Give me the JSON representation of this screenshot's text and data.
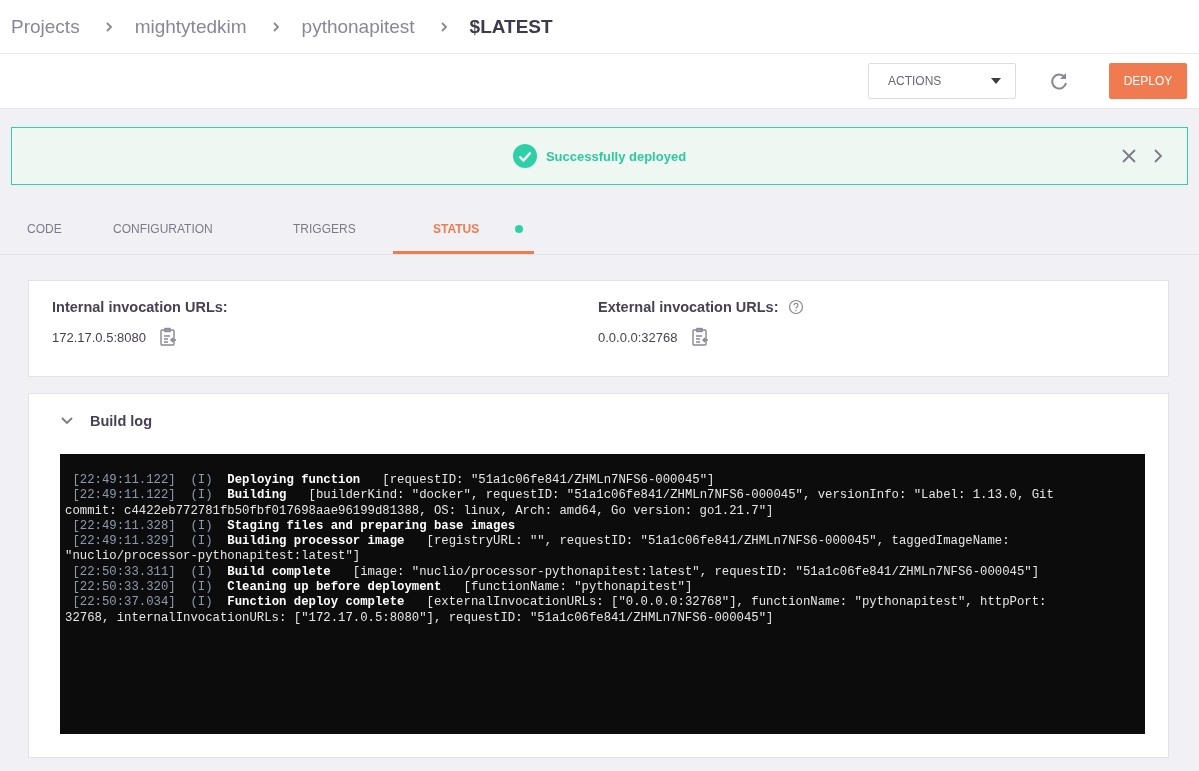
{
  "breadcrumbs": [
    {
      "label": "Projects",
      "current": false
    },
    {
      "label": "mightytedkim",
      "current": false
    },
    {
      "label": "pythonapitest",
      "current": false
    },
    {
      "label": "$LATEST",
      "current": true
    }
  ],
  "toolbar": {
    "actions": "ACTIONS",
    "deploy": "DEPLOY"
  },
  "alert": {
    "message": "Successfully deployed"
  },
  "tabs": [
    {
      "label": "CODE",
      "selected": false,
      "indicator": false
    },
    {
      "label": "CONFIGURATION",
      "selected": false,
      "indicator": false
    },
    {
      "label": "TRIGGERS",
      "selected": false,
      "indicator": false
    },
    {
      "label": "STATUS",
      "selected": true,
      "indicator": true
    }
  ],
  "invocation": {
    "internal": {
      "title": "Internal invocation URLs:",
      "url": "172.17.0.5:8080",
      "help": false
    },
    "external": {
      "title": "External invocation URLs:",
      "url": "0.0.0.0:32768",
      "help": true
    }
  },
  "build_log": {
    "title": "Build log",
    "expanded": true,
    "entries": [
      {
        "time": "[22:49:11.122]",
        "level": "(I)",
        "message": "Deploying function",
        "details": "[requestID: \"51a1c06fe841/ZHMLn7NFS6-000045\"]"
      },
      {
        "time": "[22:49:11.122]",
        "level": "(I)",
        "message": "Building",
        "details": "[builderKind: \"docker\", requestID: \"51a1c06fe841/ZHMLn7NFS6-000045\", versionInfo: \"Label: 1.13.0, Git commit: c4422eb772781fb50fbf017698aae96199d81388, OS: linux, Arch: amd64, Go version: go1.21.7\"]"
      },
      {
        "time": "[22:49:11.328]",
        "level": "(I)",
        "message": "Staging files and preparing base images"
      },
      {
        "time": "[22:49:11.329]",
        "level": "(I)",
        "message": "Building processor image",
        "details": "[registryURL: \"\", requestID: \"51a1c06fe841/ZHMLn7NFS6-000045\", taggedImageName: \"nuclio/processor-pythonapitest:latest\"]"
      },
      {
        "time": "[22:50:33.311]",
        "level": "(I)",
        "message": "Build complete",
        "details": "[image: \"nuclio/processor-pythonapitest:latest\", requestID: \"51a1c06fe841/ZHMLn7NFS6-000045\"]"
      },
      {
        "time": "[22:50:33.320]",
        "level": "(I)",
        "message": "Cleaning up before deployment",
        "details": "[functionName: \"pythonapitest\"]"
      },
      {
        "time": "[22:50:37.034]",
        "level": "(I)",
        "message": "Function deploy complete",
        "details": "[externalInvocationURLs: [\"0.0.0.0:32768\"], functionName: \"pythonapitest\", httpPort: 32768, internalInvocationURLs: [\"172.17.0.5:8080\"], requestID: \"51a1c06fe841/ZHMLn7NFS6-000045\"]"
      }
    ]
  }
}
